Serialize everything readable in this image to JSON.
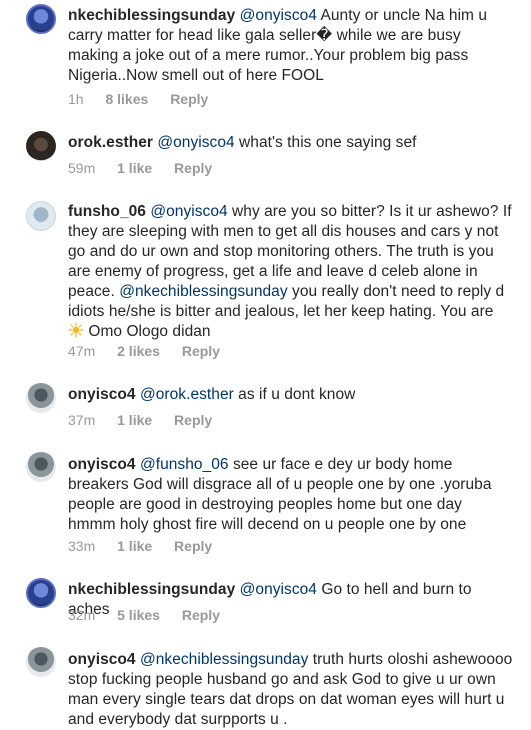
{
  "comments": [
    {
      "username": "nkechiblessingsunday",
      "mention": "@onyisco4",
      "text": " Aunty or uncle Na him u carry matter for head like gala seller� while we are busy making a joke out of a mere rumor..Your problem big pass Nigeria..Now smell out of here FOOL",
      "time": "1h",
      "likes": "8 likes",
      "reply": "Reply"
    },
    {
      "username": "orok.esther",
      "mention": "@onyisco4",
      "text": " what's this one saying sef",
      "time": "59m",
      "likes": "1 like",
      "reply": "Reply"
    },
    {
      "username": "funsho_06",
      "mention": "@onyisco4",
      "text_before_mention2": " why are you so bitter? Is it ur ashewo? If they are sleeping with men to get all dis houses and cars y not go and do ur own and stop monitoring others. The truth is you are enemy of progress, get a life and leave d celeb alone in peace. ",
      "mention2": "@nkechiblessingsunday",
      "text_after_mention2": " you really don't need to reply d idiots he/she is bitter and jealous, let her keep hating. You are ",
      "emoji_icon": "sparkle-emoji-icon",
      "text_end": " Omo Ologo didan",
      "time": "47m",
      "likes": "2 likes",
      "reply": "Reply"
    },
    {
      "username": "onyisco4",
      "mention": "@orok.esther",
      "text": " as if u dont know",
      "time": "37m",
      "likes": "1 like",
      "reply": "Reply"
    },
    {
      "username": "onyisco4",
      "mention": "@funsho_06",
      "text": " see ur face  e dey ur body home breakers God will disgrace all of u people one by one .yoruba people are good in destroying peoples home but one day hmmm holy ghost fire will decend on u people one by one",
      "time": "33m",
      "likes": "1 like",
      "reply": "Reply"
    },
    {
      "username": "nkechiblessingsunday",
      "mention": "@onyisco4",
      "text": " Go to hell and burn to aches",
      "time": "32m",
      "likes": "5 likes",
      "reply": "Reply"
    },
    {
      "username": "onyisco4",
      "mention": "@nkechiblessingsunday",
      "text": " truth hurts oloshi ashewoooo stop fucking people husband go and ask God to give u ur own  man every single tears dat drops on dat woman eyes will hurt u and everybody dat surpports u ."
    }
  ]
}
